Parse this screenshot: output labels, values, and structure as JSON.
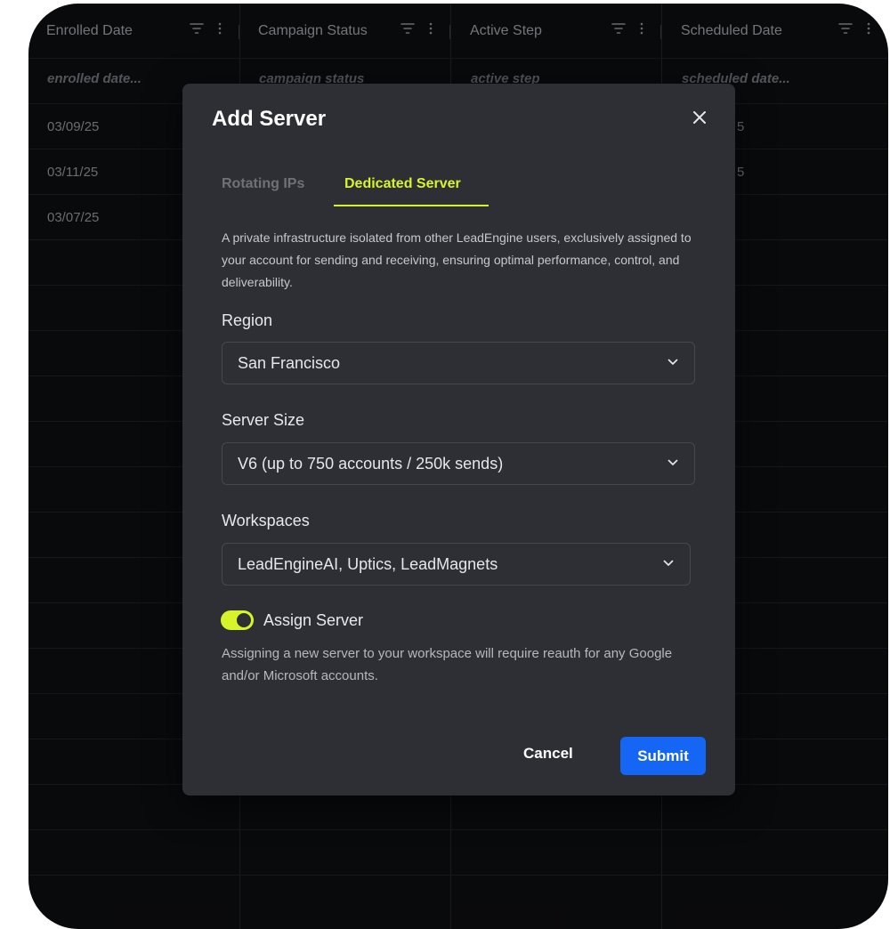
{
  "table": {
    "columns": [
      {
        "label": "Enrolled Date",
        "filter_placeholder": "enrolled date..."
      },
      {
        "label": "Campaign Status",
        "filter_placeholder": "campaign status"
      },
      {
        "label": "Active Step",
        "filter_placeholder": "active step"
      },
      {
        "label": "Scheduled Date",
        "filter_placeholder": "scheduled date..."
      }
    ],
    "rows": [
      {
        "enrolled": "03/09/25",
        "scheduled_tail": "5"
      },
      {
        "enrolled": "03/11/25",
        "scheduled_tail": "5"
      },
      {
        "enrolled": "03/07/25",
        "scheduled_tail": ""
      }
    ]
  },
  "modal": {
    "title": "Add Server",
    "close_icon": "close-icon",
    "tabs": [
      {
        "label": "Rotating IPs",
        "active": false
      },
      {
        "label": "Dedicated Server",
        "active": true
      }
    ],
    "description": "A private infrastructure isolated from other LeadEngine users, exclusively assigned to your account for sending and receiving, ensuring optimal performance, control, and deliverability.",
    "region": {
      "label": "Region",
      "value": "San Francisco"
    },
    "server_size": {
      "label": "Server Size",
      "value": "V6 (up to 750 accounts / 250k sends)"
    },
    "workspaces": {
      "label": "Workspaces",
      "value": "LeadEngineAI, Uptics, LeadMagnets"
    },
    "assign": {
      "label": "Assign Server",
      "enabled": true
    },
    "note": "Assigning a new server to your workspace will require reauth for any Google and/or Microsoft accounts.",
    "cancel_label": "Cancel",
    "submit_label": "Submit"
  },
  "colors": {
    "accent": "#d7f42b",
    "primary_button": "#1566f5",
    "modal_bg": "#2e2f34",
    "page_bg": "#0d0e10"
  }
}
